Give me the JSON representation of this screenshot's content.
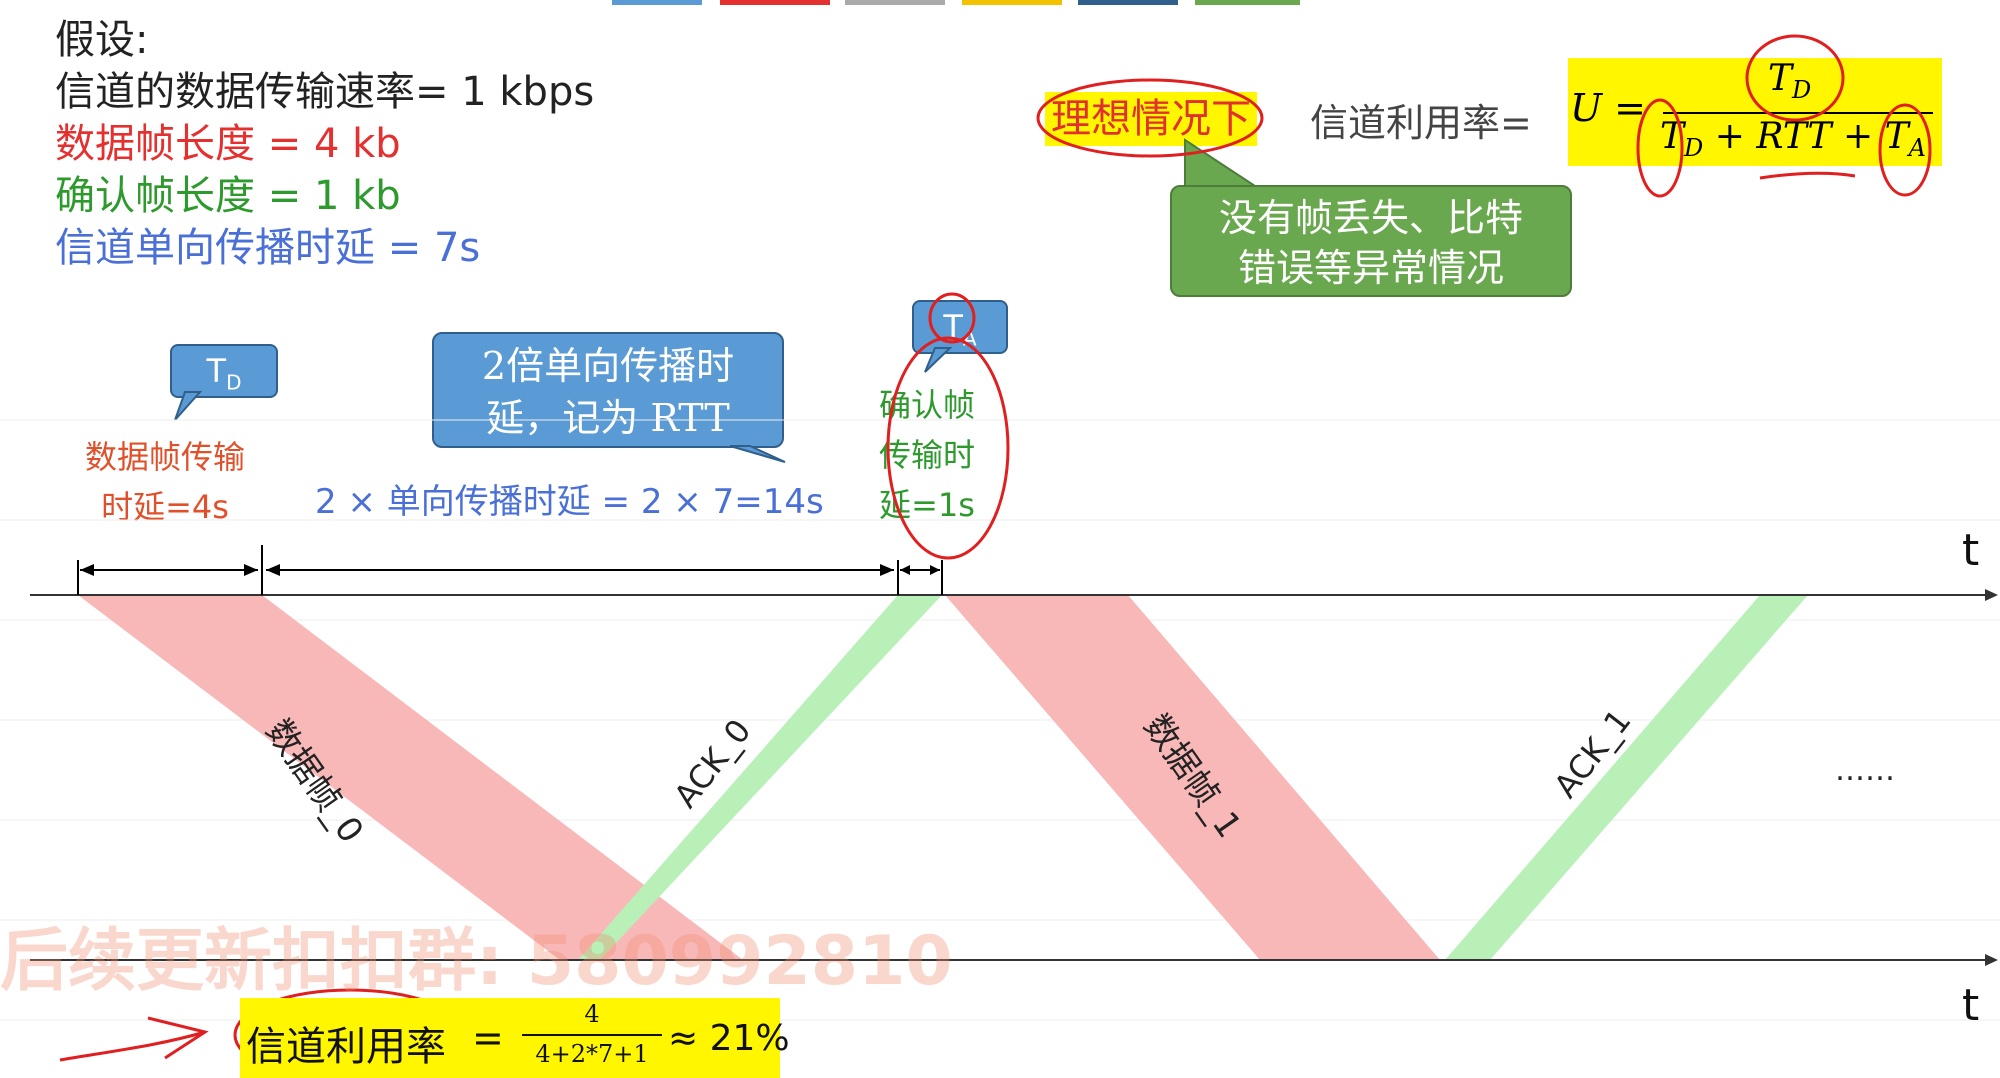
{
  "assumptions": {
    "heading": "假设:",
    "rate": "信道的数据传输速率= 1 kbps",
    "data_frame": "数据帧长度 = 4 kb",
    "ack_frame": "确认帧长度 = 1 kb",
    "prop_delay": "信道单向传播时延 = 7s"
  },
  "ideal_label": "理想情况下",
  "util_label": "信道利用率=",
  "formula": {
    "lhs": "U =",
    "numerator": "T",
    "numerator_sub": "D",
    "den_t": "T",
    "den_t_sub": "D",
    "den_plus1": "+",
    "den_rtt": "RTT",
    "den_plus2": "+",
    "den_ta": "T",
    "den_ta_sub": "A"
  },
  "green_note": {
    "line1": "没有帧丢失、比特",
    "line2": "错误等异常情况"
  },
  "callout_td": {
    "t": "T",
    "sub": "D"
  },
  "callout_ta": {
    "t": "T",
    "sub": "A"
  },
  "callout_rtt": {
    "line1": "2倍单向传播时",
    "line2": "延，记为 RTT"
  },
  "data_tx": {
    "line1": "数据帧传输",
    "line2": "时延=4s"
  },
  "rtt_label": "2 × 单向传播时延 = 2 × 7=14s",
  "ack_tx": {
    "line1": "确认帧",
    "line2": "传输时",
    "line3": "延=1s"
  },
  "axis_label_top": "t",
  "axis_label_bottom": "t",
  "frames": {
    "data0": "数据帧_0",
    "ack0": "ACK_0",
    "data1": "数据帧_1",
    "ack1": "ACK_1"
  },
  "ellipsis": "……",
  "watermark": "后续更新扣扣群: 580992810",
  "result": {
    "label": "信道利用率",
    "eq": "=",
    "num": "4",
    "den": "4+2*7+1",
    "approx": "≈ 21%"
  },
  "colors": {
    "red": "#e53030",
    "green": "#2e9a2e",
    "blue": "#4a6fd6",
    "orange_red": "#e0502a",
    "data_fill": "#f9b8b8",
    "ack_fill": "#b8f0b8",
    "highlight": "#fff600",
    "callout": "#5b9bd5",
    "note_green": "#6aa84f"
  }
}
